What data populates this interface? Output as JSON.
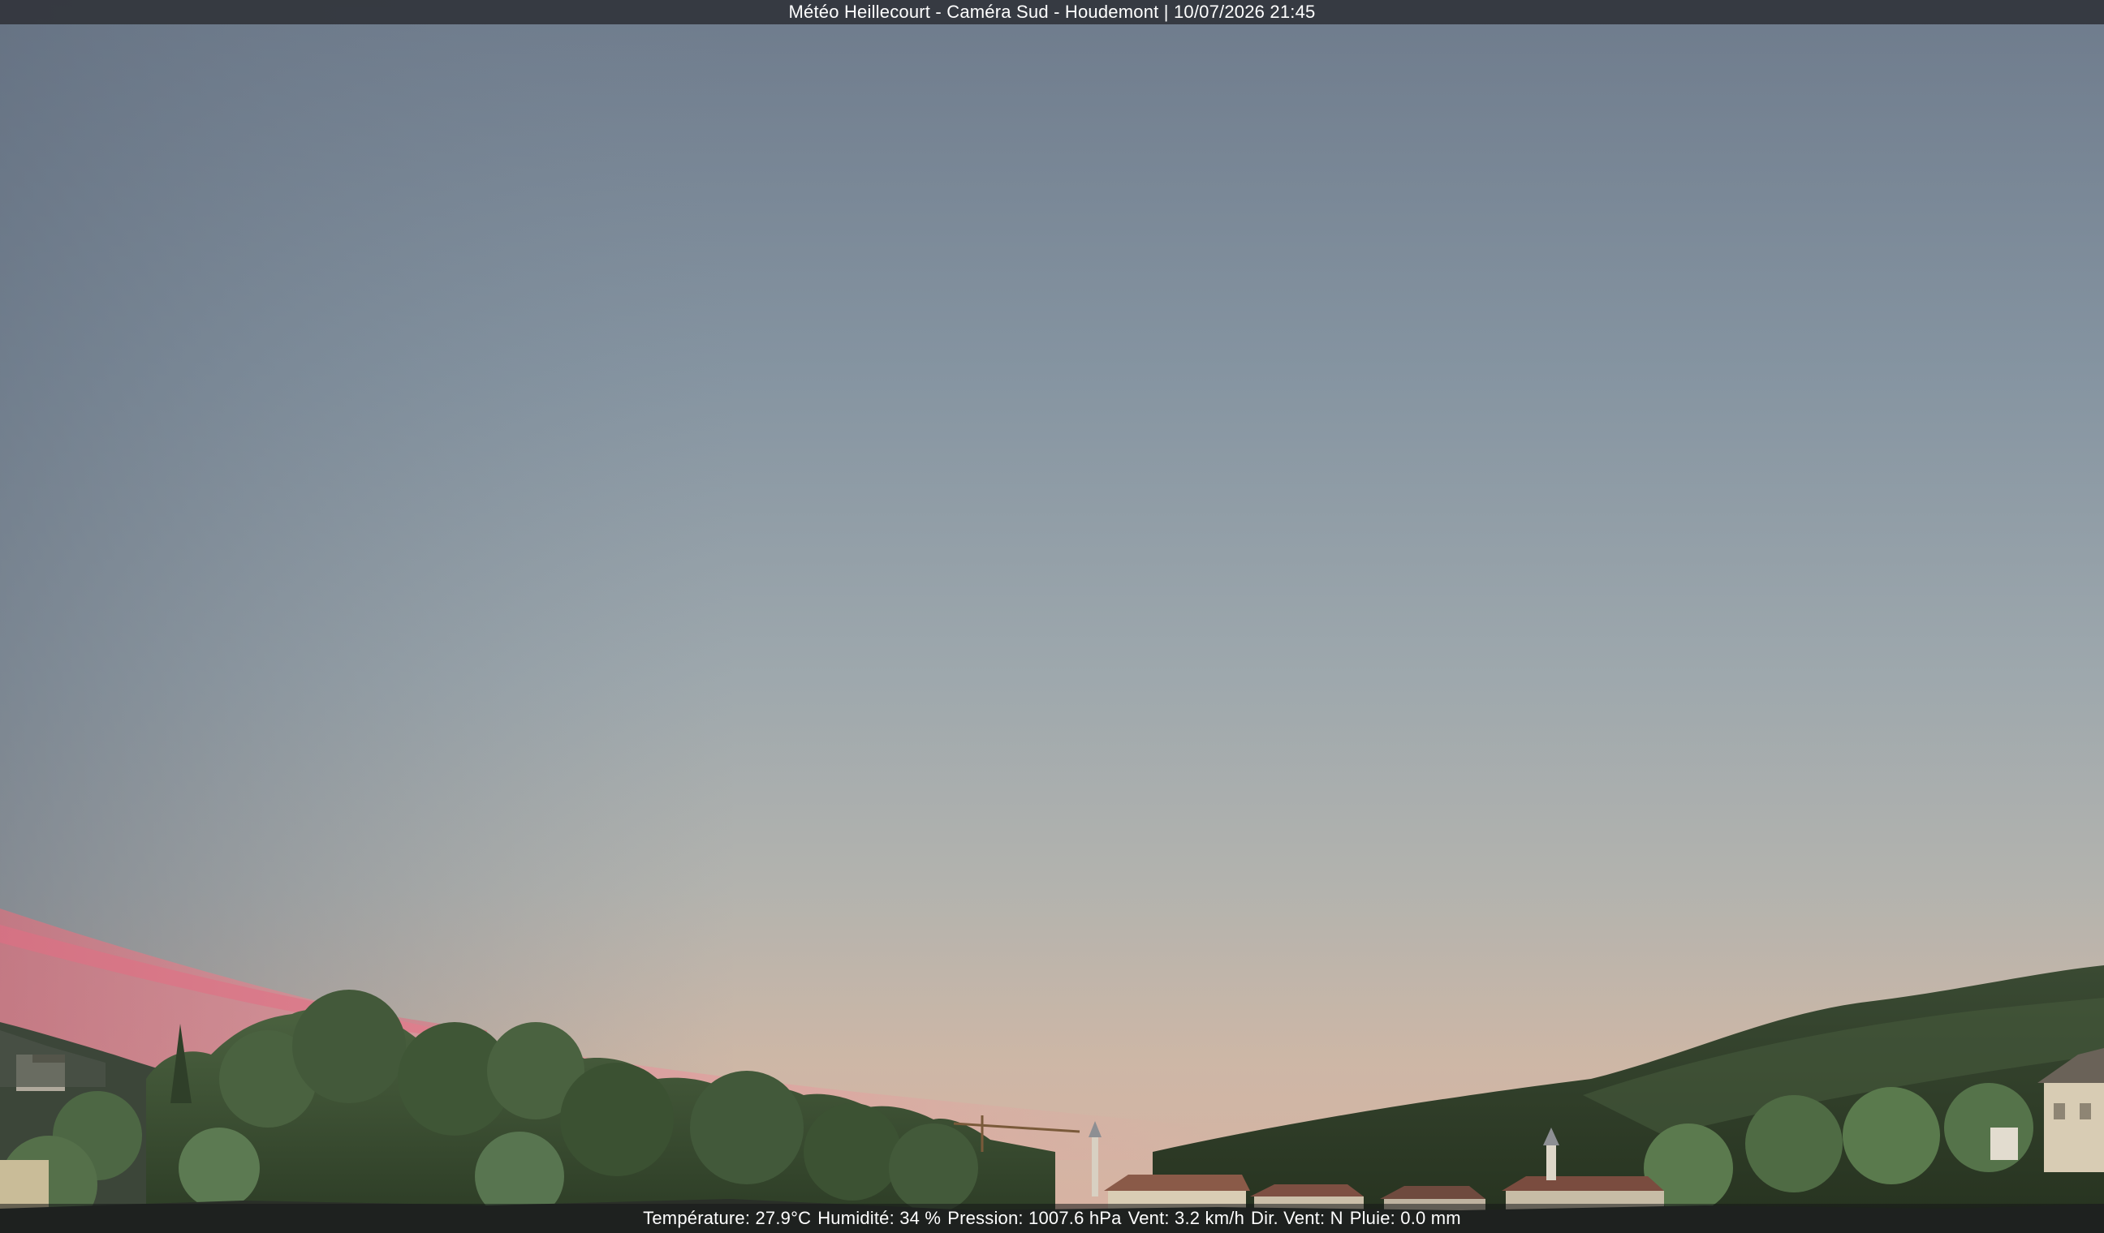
{
  "overlay": {
    "title": "Météo Heillecourt - Caméra Sud - Houdemont | 10/07/2026 21:45"
  },
  "weather": {
    "temperature_label": "Température:",
    "temperature_value": "27.9°C",
    "humidity_label": "Humidité:",
    "humidity_value": "34 %",
    "pressure_label": "Pression:",
    "pressure_value": "1007.6 hPa",
    "wind_label": "Vent:",
    "wind_value": "3.2 km/h",
    "wind_dir_label": "Dir. Vent:",
    "wind_dir_value": "N",
    "rain_label": "Pluie:",
    "rain_value": "0.0 mm"
  },
  "colors": {
    "sky_top": "#6f7d8e",
    "sky_mid": "#97a3ab",
    "sky_horizon": "#d3b8a4",
    "sunset_pink": "#e0848f",
    "hills": "#2f3f2a",
    "trees": "#3b5530",
    "roofs": "#7a4e40",
    "walls": "#d8ccb8"
  }
}
